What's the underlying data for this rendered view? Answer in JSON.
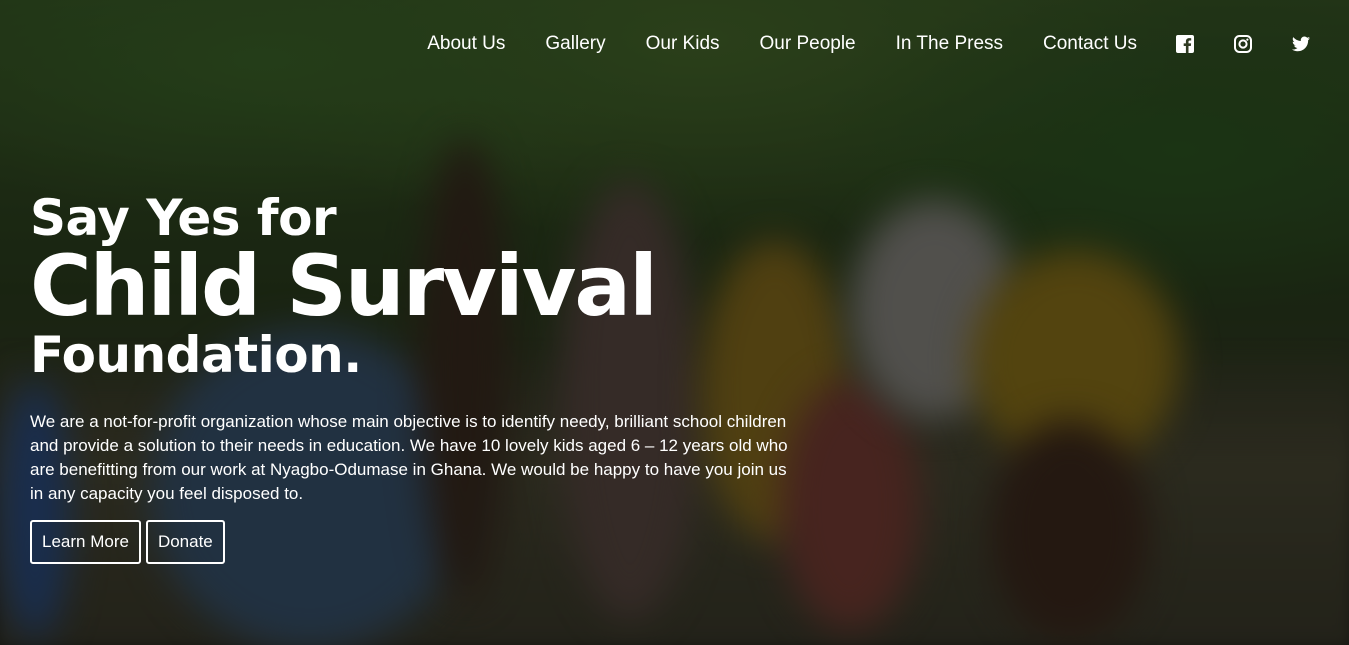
{
  "nav": {
    "links": [
      "About Us",
      "Gallery",
      "Our Kids",
      "Our People",
      "In The Press",
      "Contact Us"
    ],
    "social": [
      "facebook-icon",
      "instagram-icon",
      "twitter-icon"
    ]
  },
  "hero": {
    "title_top": "Say Yes for",
    "title_main": "Child Survival",
    "title_bottom": "Foundation.",
    "description": "We are a not-for-profit organization whose main objective is to identify needy, brilliant school children and provide a solution to their needs in education. We have 10 lovely kids aged 6 – 12 years old who are benefitting from our work at Nyagbo-Odumase in Ghana. We would be happy to have you join us in any capacity you feel disposed to.",
    "buttons": {
      "learn_more": "Learn More",
      "donate": "Donate"
    }
  },
  "colors": {
    "text": "#ffffff",
    "overlay": "rgba(0,0,0,0.42)"
  }
}
